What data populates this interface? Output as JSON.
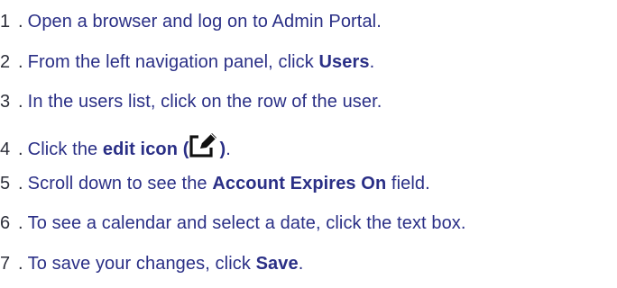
{
  "steps": [
    {
      "number": "1",
      "before": "Open a browser and log on to Admin Portal.",
      "bold": "",
      "after": ""
    },
    {
      "number": "2",
      "before": "From the left navigation panel, click ",
      "bold": "Users",
      "after": "."
    },
    {
      "number": "3",
      "before": "In the users list, click on the row of the user.",
      "bold": "",
      "after": ""
    },
    {
      "number": "4",
      "before": "Click the ",
      "bold": "edit icon (",
      "bold_after_icon": ")",
      "after": ".",
      "icon": "edit-icon"
    },
    {
      "number": "5",
      "before": "Scroll down to see the ",
      "bold": "Account Expires On",
      "after": " field."
    },
    {
      "number": "6",
      "before": "To see a calendar and select a date, click the text box.",
      "bold": "",
      "after": ""
    },
    {
      "number": "7",
      "before": "To save your changes, click ",
      "bold": "Save",
      "after": "."
    }
  ],
  "colors": {
    "step_text": "#2a2f86",
    "number_text": "#2d2f3a",
    "background": "#ffffff"
  }
}
